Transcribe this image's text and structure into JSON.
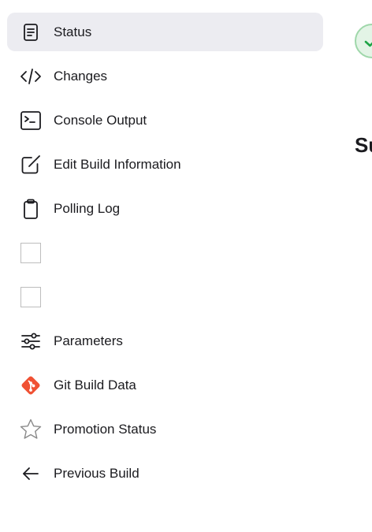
{
  "sidebar": {
    "items": [
      {
        "label": "Status",
        "icon": "document-icon",
        "active": true
      },
      {
        "label": "Changes",
        "icon": "code-icon",
        "active": false
      },
      {
        "label": "Console Output",
        "icon": "terminal-icon",
        "active": false
      },
      {
        "label": "Edit Build Information",
        "icon": "edit-icon",
        "active": false
      },
      {
        "label": "Polling Log",
        "icon": "clipboard-icon",
        "active": false
      },
      {
        "label": "",
        "icon": "placeholder-image-icon",
        "active": false
      },
      {
        "label": "",
        "icon": "placeholder-image-icon",
        "active": false
      },
      {
        "label": "Parameters",
        "icon": "sliders-icon",
        "active": false
      },
      {
        "label": "Git Build Data",
        "icon": "git-icon",
        "active": false
      },
      {
        "label": "Promotion Status",
        "icon": "star-icon",
        "active": false
      },
      {
        "label": "Previous Build",
        "icon": "arrow-left-icon",
        "active": false
      }
    ]
  },
  "main": {
    "status_icon": "success-check-icon",
    "heading_fragment": "Su"
  },
  "colors": {
    "active_background": "#ececf1",
    "text": "#1b1b1f",
    "success_green": "#1ea446",
    "git_orange": "#f05133"
  }
}
